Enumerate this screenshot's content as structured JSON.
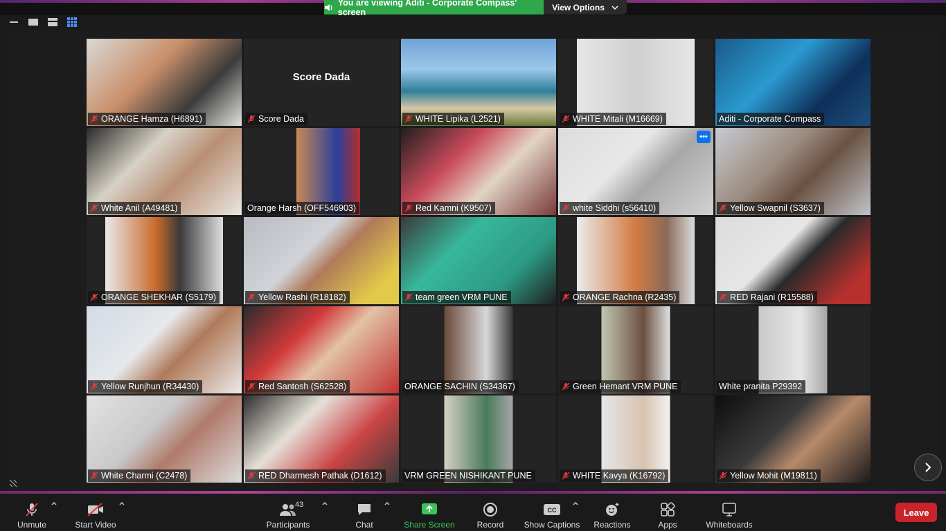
{
  "banner": {
    "text": "You are viewing Aditi - Corporate Compass' screen",
    "view_options": "View Options"
  },
  "tiles": [
    {
      "label": "ORANGE Hamza (H6891)",
      "muted": true,
      "bg": "linear-gradient(135deg,#d9d9d6,#c98f6a 40%,#3b3b3b 70%,#e2e2dc)"
    },
    {
      "label": "Score Dada",
      "muted": true,
      "center": "Score Dada",
      "bg": "#242424"
    },
    {
      "label": "WHITE Lipika (L2521)",
      "muted": true,
      "bg": "linear-gradient(180deg,#6fa3d6 0%,#9cc7ea 35%,#2f7f9a 60%,#d7c8a6 80%,#6b7a3a 100%)"
    },
    {
      "label": "WHITE Mitali (M16669)",
      "muted": true,
      "bg": "linear-gradient(90deg,#242424 12%,#e6e6e6 12%,#d0d0d0 50%,#e6e6e6 88%,#242424 88%)"
    },
    {
      "label": "Aditi - Corporate Compass",
      "muted": false,
      "bg": "linear-gradient(135deg,#1a5a8a,#2a9ad0 40%,#0f2f5a 70%,#1b4f7a)"
    },
    {
      "label": "White Anil (A49481)",
      "muted": true,
      "bg": "linear-gradient(135deg,#2b2b2b,#d8d2c6 35%,#b88f74 60%,#eae6df)"
    },
    {
      "label": "Orange Harsh (OFF546903)",
      "muted": false,
      "bg": "linear-gradient(90deg,#242424 34%,#c78a55 34%,#2a3f9a 60%,#b22f2f 75%,#242424 75%)"
    },
    {
      "label": "Red Kamni (K9507)",
      "muted": true,
      "bg": "linear-gradient(135deg,#1f1f1f,#c94b5a 35%,#e2d4c4 60%,#7a3a3a)"
    },
    {
      "label": "white Siddhi (s56410)",
      "muted": true,
      "more": true,
      "bg": "linear-gradient(135deg,#dcdcdc,#e8e8e8 40%,#a7a7a7 60%,#d2d2d2)"
    },
    {
      "label": "Yellow Swapnil (S3637)",
      "muted": true,
      "bg": "linear-gradient(135deg,#c6cbd1,#9a8b7f 40%,#6a5141 60%,#bfc4ca)"
    },
    {
      "label": "ORANGE SHEKHAR (S5179)",
      "muted": true,
      "bg": "linear-gradient(90deg,#242424 12%,#e9e9e9 12%,#c86a2a 45%,#3a3a3a 60%,#dedede 88%,#242424 88%)"
    },
    {
      "label": "Yellow Rashi (R18182)",
      "muted": true,
      "active": true,
      "bg": "linear-gradient(135deg,#b8bcc2,#d0d4d8 40%,#b07a5a 55%,#e3c94a 85%)"
    },
    {
      "label": "team green VRM PUNE",
      "muted": true,
      "bg": "linear-gradient(135deg,#3a3a3a,#37b89a 35%,#2c9a82 70%,#1e1e1e)"
    },
    {
      "label": "ORANGE Rachna (R2435)",
      "muted": true,
      "bg": "linear-gradient(90deg,#242424 12%,#ececec 12%,#d37a42 50%,#8a6a5a 70%,#dcdcdc 88%,#242424 88%)"
    },
    {
      "label": "RED Rajani (R15588)",
      "muted": true,
      "bg": "linear-gradient(135deg,#dcdcdc,#e6e6e6 40%,#2a2a2a 55%,#b8302e 85%)"
    },
    {
      "label": "Yellow Runjhun (R34430)",
      "muted": true,
      "bg": "linear-gradient(135deg,#d2dbe6,#e6e8ea 40%,#b07a5a 60%,#eceae8)"
    },
    {
      "label": "Red Santosh (S62528)",
      "muted": true,
      "bg": "linear-gradient(135deg,#2b2b2b,#d23a3a 35%,#e2c2a6 55%,#c23030)"
    },
    {
      "label": "ORANGE SACHIN (S34367)",
      "muted": false,
      "bg": "linear-gradient(90deg,#242424 28%,#6a4a3a 28%,#d8d8d8 55%,#3a3a3a 72%,#242424 72%)"
    },
    {
      "label": "Green Hemant VRM PUNE",
      "muted": true,
      "bg": "linear-gradient(90deg,#242424 28%,#c2c6b2 28%,#6b5040 55%,#e0e0e0 72%,#242424 72%)"
    },
    {
      "label": "White pranita P29392",
      "muted": false,
      "bg": "linear-gradient(90deg,#242424 28%,#c9c9c9 28%,#e6e6e6 55%,#a6a6a6 72%,#242424 72%)"
    },
    {
      "label": "White Charmi (C2478)",
      "muted": true,
      "bg": "linear-gradient(135deg,#e2e2e2,#c9c9c9 40%,#b07a6a 60%,#dcdcdc)"
    },
    {
      "label": "RED Dharmesh Pathak (D1612)",
      "muted": true,
      "bg": "linear-gradient(135deg,#2e2e2e,#e6e0d8 35%,#c94444 65%,#3a3a3a)"
    },
    {
      "label": "VRM GREEN NISHIKANT PUNE",
      "muted": false,
      "bg": "linear-gradient(90deg,#242424 28%,#d6d0c4 28%,#4a7a5a 55%,#a6a6a6 72%,#242424 72%)"
    },
    {
      "label": "WHITE Kavya (K16792)",
      "muted": true,
      "bg": "linear-gradient(90deg,#242424 28%,#e6e6e6 28%,#d8c2b0 55%,#f2f2f2 72%,#242424 72%)"
    },
    {
      "label": "Yellow Mohit (M19811)",
      "muted": true,
      "bg": "linear-gradient(135deg,#0e0e0e,#3a3a3a 40%,#b88a6a 60%,#1a1a1a)"
    }
  ],
  "toolbar": {
    "unmute": "Unmute",
    "start_video": "Start Video",
    "participants": "Participants",
    "participants_count": "43",
    "chat": "Chat",
    "share_screen": "Share Screen",
    "record": "Record",
    "show_captions": "Show Captions",
    "reactions": "Reactions",
    "apps": "Apps",
    "whiteboards": "Whiteboards",
    "leave": "Leave"
  },
  "colors": {
    "share_green": "#3ec25a",
    "leave_red": "#c8242a",
    "banner_green": "#2ea84a",
    "active_speaker": "#f2e15a",
    "more_blue": "#0e71eb"
  }
}
